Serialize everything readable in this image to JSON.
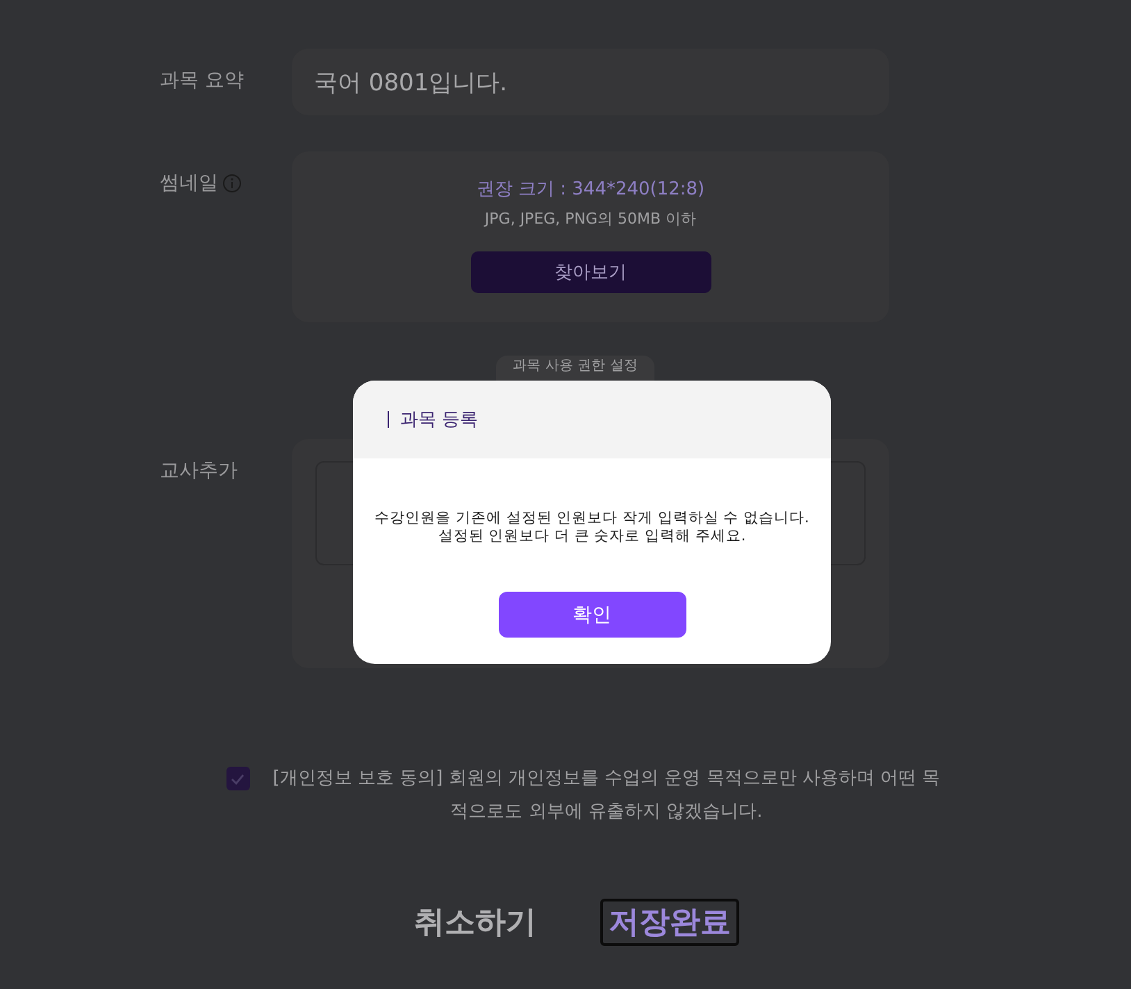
{
  "form": {
    "summary": {
      "label": "과목 요약",
      "value": "국어 0801입니다."
    },
    "thumbnail": {
      "label": "썸네일",
      "size_hint": "권장 크기 : 344*240(12:8)",
      "format_hint": "JPG, JPEG, PNG의 50MB 이하",
      "browse_button": "찾아보기"
    },
    "permission_button": "과목 사용 권한 설정",
    "teacher": {
      "label": "교사추가"
    }
  },
  "consent": {
    "checked": true,
    "text": "[개인정보 보호 동의] 회원의 개인정보를 수업의 운영 목적으로만 사용하며 어떤 목적으로도 외부에 유출하지 않겠습니다."
  },
  "actions": {
    "cancel": "취소하기",
    "save": "저장완료"
  },
  "modal": {
    "title": "과목 등록",
    "message_lines": [
      "수강인원을 기존에 설정된 인원보다 작게 입력하실 수 없습니다.",
      "설정된 인원보다 더 큰 숫자로 입력해 주세요."
    ],
    "confirm": "확인"
  }
}
